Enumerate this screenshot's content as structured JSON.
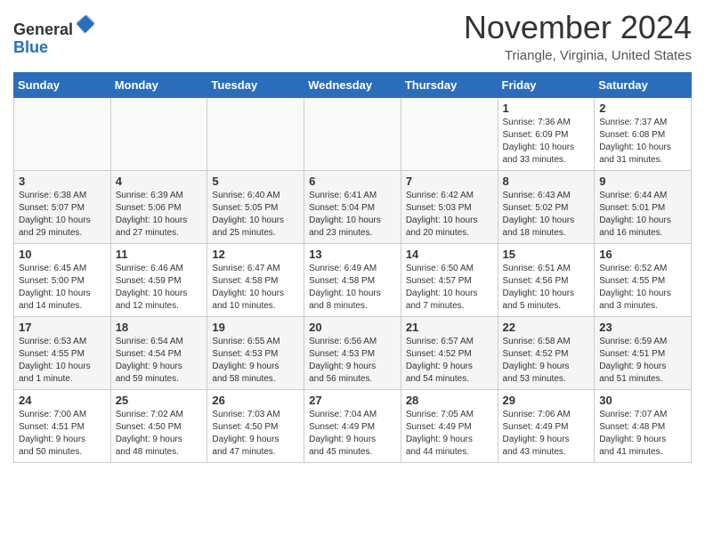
{
  "header": {
    "logo_line1": "General",
    "logo_line2": "Blue",
    "month": "November 2024",
    "location": "Triangle, Virginia, United States"
  },
  "days_of_week": [
    "Sunday",
    "Monday",
    "Tuesday",
    "Wednesday",
    "Thursday",
    "Friday",
    "Saturday"
  ],
  "weeks": [
    [
      {
        "day": "",
        "info": ""
      },
      {
        "day": "",
        "info": ""
      },
      {
        "day": "",
        "info": ""
      },
      {
        "day": "",
        "info": ""
      },
      {
        "day": "",
        "info": ""
      },
      {
        "day": "1",
        "info": "Sunrise: 7:36 AM\nSunset: 6:09 PM\nDaylight: 10 hours\nand 33 minutes."
      },
      {
        "day": "2",
        "info": "Sunrise: 7:37 AM\nSunset: 6:08 PM\nDaylight: 10 hours\nand 31 minutes."
      }
    ],
    [
      {
        "day": "3",
        "info": "Sunrise: 6:38 AM\nSunset: 5:07 PM\nDaylight: 10 hours\nand 29 minutes."
      },
      {
        "day": "4",
        "info": "Sunrise: 6:39 AM\nSunset: 5:06 PM\nDaylight: 10 hours\nand 27 minutes."
      },
      {
        "day": "5",
        "info": "Sunrise: 6:40 AM\nSunset: 5:05 PM\nDaylight: 10 hours\nand 25 minutes."
      },
      {
        "day": "6",
        "info": "Sunrise: 6:41 AM\nSunset: 5:04 PM\nDaylight: 10 hours\nand 23 minutes."
      },
      {
        "day": "7",
        "info": "Sunrise: 6:42 AM\nSunset: 5:03 PM\nDaylight: 10 hours\nand 20 minutes."
      },
      {
        "day": "8",
        "info": "Sunrise: 6:43 AM\nSunset: 5:02 PM\nDaylight: 10 hours\nand 18 minutes."
      },
      {
        "day": "9",
        "info": "Sunrise: 6:44 AM\nSunset: 5:01 PM\nDaylight: 10 hours\nand 16 minutes."
      }
    ],
    [
      {
        "day": "10",
        "info": "Sunrise: 6:45 AM\nSunset: 5:00 PM\nDaylight: 10 hours\nand 14 minutes."
      },
      {
        "day": "11",
        "info": "Sunrise: 6:46 AM\nSunset: 4:59 PM\nDaylight: 10 hours\nand 12 minutes."
      },
      {
        "day": "12",
        "info": "Sunrise: 6:47 AM\nSunset: 4:58 PM\nDaylight: 10 hours\nand 10 minutes."
      },
      {
        "day": "13",
        "info": "Sunrise: 6:49 AM\nSunset: 4:58 PM\nDaylight: 10 hours\nand 8 minutes."
      },
      {
        "day": "14",
        "info": "Sunrise: 6:50 AM\nSunset: 4:57 PM\nDaylight: 10 hours\nand 7 minutes."
      },
      {
        "day": "15",
        "info": "Sunrise: 6:51 AM\nSunset: 4:56 PM\nDaylight: 10 hours\nand 5 minutes."
      },
      {
        "day": "16",
        "info": "Sunrise: 6:52 AM\nSunset: 4:55 PM\nDaylight: 10 hours\nand 3 minutes."
      }
    ],
    [
      {
        "day": "17",
        "info": "Sunrise: 6:53 AM\nSunset: 4:55 PM\nDaylight: 10 hours\nand 1 minute."
      },
      {
        "day": "18",
        "info": "Sunrise: 6:54 AM\nSunset: 4:54 PM\nDaylight: 9 hours\nand 59 minutes."
      },
      {
        "day": "19",
        "info": "Sunrise: 6:55 AM\nSunset: 4:53 PM\nDaylight: 9 hours\nand 58 minutes."
      },
      {
        "day": "20",
        "info": "Sunrise: 6:56 AM\nSunset: 4:53 PM\nDaylight: 9 hours\nand 56 minutes."
      },
      {
        "day": "21",
        "info": "Sunrise: 6:57 AM\nSunset: 4:52 PM\nDaylight: 9 hours\nand 54 minutes."
      },
      {
        "day": "22",
        "info": "Sunrise: 6:58 AM\nSunset: 4:52 PM\nDaylight: 9 hours\nand 53 minutes."
      },
      {
        "day": "23",
        "info": "Sunrise: 6:59 AM\nSunset: 4:51 PM\nDaylight: 9 hours\nand 51 minutes."
      }
    ],
    [
      {
        "day": "24",
        "info": "Sunrise: 7:00 AM\nSunset: 4:51 PM\nDaylight: 9 hours\nand 50 minutes."
      },
      {
        "day": "25",
        "info": "Sunrise: 7:02 AM\nSunset: 4:50 PM\nDaylight: 9 hours\nand 48 minutes."
      },
      {
        "day": "26",
        "info": "Sunrise: 7:03 AM\nSunset: 4:50 PM\nDaylight: 9 hours\nand 47 minutes."
      },
      {
        "day": "27",
        "info": "Sunrise: 7:04 AM\nSunset: 4:49 PM\nDaylight: 9 hours\nand 45 minutes."
      },
      {
        "day": "28",
        "info": "Sunrise: 7:05 AM\nSunset: 4:49 PM\nDaylight: 9 hours\nand 44 minutes."
      },
      {
        "day": "29",
        "info": "Sunrise: 7:06 AM\nSunset: 4:49 PM\nDaylight: 9 hours\nand 43 minutes."
      },
      {
        "day": "30",
        "info": "Sunrise: 7:07 AM\nSunset: 4:48 PM\nDaylight: 9 hours\nand 41 minutes."
      }
    ]
  ]
}
